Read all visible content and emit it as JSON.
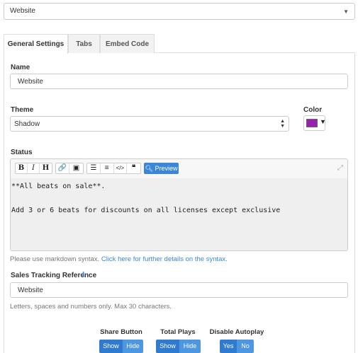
{
  "top_select": {
    "value": "Website"
  },
  "tabs": [
    {
      "label": "General Settings",
      "active": true
    },
    {
      "label": "Tabs",
      "active": false
    },
    {
      "label": "Embed Code",
      "active": false
    }
  ],
  "name": {
    "label": "Name",
    "value": "Website"
  },
  "theme": {
    "label": "Theme",
    "value": "Shadow"
  },
  "color": {
    "label": "Color",
    "value": "#9b1fb3"
  },
  "status": {
    "label": "Status",
    "toolbar": {
      "bold": "B",
      "italic": "I",
      "heading": "H",
      "preview_label": "Preview"
    },
    "line1": "**All beats on sale**.",
    "line2": "Add 3 or 6 beats for discounts on all licenses except exclusive",
    "help_prefix": "Please use markdown syntax.",
    "help_link": "Click here for further details on the syntax."
  },
  "tracking": {
    "label": "Sales Tracking Reference",
    "value": "Website",
    "help": "Letters, spaces and numbers only. Max 30 characters."
  },
  "toggles": [
    {
      "label": "Share Button",
      "options": [
        "Show",
        "Hide"
      ],
      "selected": "Show"
    },
    {
      "label": "Total Plays",
      "options": [
        "Show",
        "Hide"
      ],
      "selected": "Show"
    },
    {
      "label": "Disable Autoplay",
      "options": [
        "Yes",
        "No"
      ],
      "selected": "Yes"
    }
  ]
}
